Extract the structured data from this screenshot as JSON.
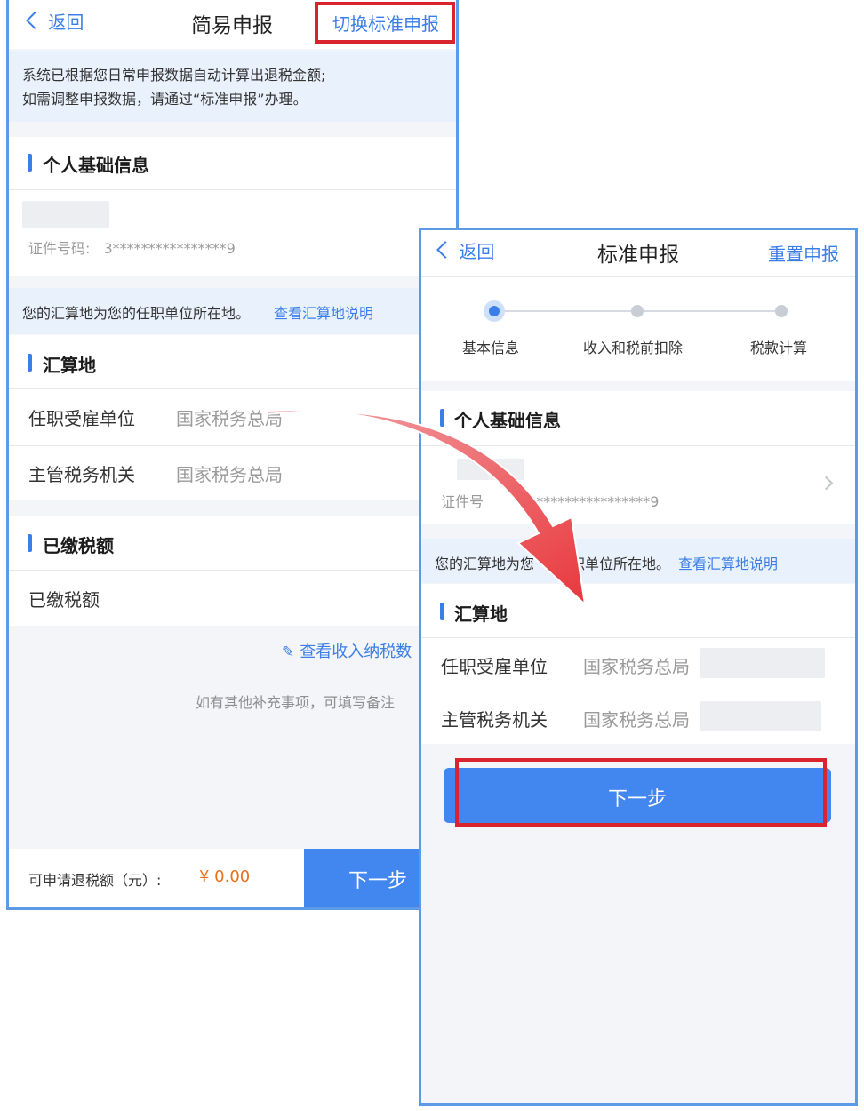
{
  "simple": {
    "back_label": "返回",
    "title": "简易申报",
    "switch_label": "切换标准申报",
    "notice_line1": "系统已根据您日常申报数据自动计算出退税金额;",
    "notice_line2": "如需调整申报数据，请通过“标准申报”办理。",
    "personal_section": "个人基础信息",
    "id_label": "证件号码:",
    "id_value": "3****************9",
    "location_notice": "您的汇算地为您的任职单位所在地。",
    "location_link": "查看汇算地说明",
    "location_section": "汇算地",
    "employer_label": "任职受雇单位",
    "employer_value": "国家税务总局",
    "tax_office_label": "主管税务机关",
    "tax_office_value": "国家税务总局",
    "paid_section": "已缴税额",
    "paid_label": "已缴税额",
    "view_income_link": "查看收入纳税数",
    "remark_hint": "如有其他补充事项，可填写备注",
    "refund_label": "可申请退税额（元）:",
    "refund_amount": "¥ 0.00",
    "next_label": "下一步"
  },
  "standard": {
    "back_label": "返回",
    "title": "标准申报",
    "reset_label": "重置申报",
    "steps": [
      "基本信息",
      "收入和税前扣除",
      "税款计算"
    ],
    "current_step": 1,
    "personal_section": "个人基础信息",
    "id_label": "证件号",
    "id_value": "3****************9",
    "location_notice_a": "您的汇算地为您",
    "location_notice_b": "职单位所在地。",
    "location_link": "查看汇算地说明",
    "location_section": "汇算地",
    "employer_label": "任职受雇单位",
    "employer_value": "国家税务总局",
    "tax_office_label": "主管税务机关",
    "tax_office_value": "国家税务总局",
    "next_label": "下一步"
  },
  "colors": {
    "accent": "#3b7ee8",
    "highlight": "#d9232d",
    "arrow": "#e8383d",
    "amount": "#e8701a"
  }
}
